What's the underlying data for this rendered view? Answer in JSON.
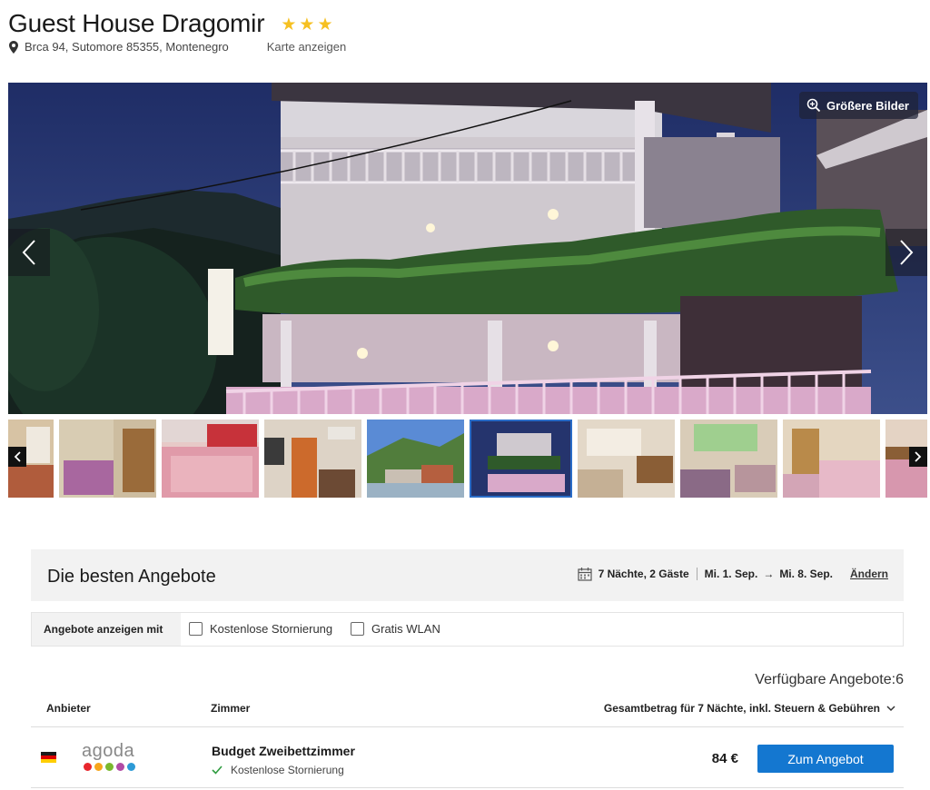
{
  "hotel": {
    "name": "Guest House Dragomir",
    "stars": 3,
    "address": "Brca 94, Sutomore 85355, Montenegro",
    "map_link": "Karte anzeigen"
  },
  "gallery": {
    "zoom_label": "Größere Bilder",
    "thumbnail_count": 10,
    "selected_thumbnail": 6
  },
  "offers": {
    "title": "Die besten Angebote",
    "stay": "7 Nächte, 2 Gäste",
    "checkin": "Mi. 1. Sep.",
    "arrow": "→",
    "checkout": "Mi. 8. Sep.",
    "change_link": "Ändern",
    "filter_label": "Angebote anzeigen mit",
    "filters": [
      "Kostenlose Stornierung",
      "Gratis WLAN"
    ],
    "available": "Verfügbare Angebote:6",
    "columns": {
      "provider": "Anbieter",
      "room": "Zimmer",
      "total": "Gesamtbetrag für 7 Nächte, inkl. Steuern & Gebühren"
    },
    "rows": [
      {
        "provider": "agoda",
        "room": "Budget Zweibettzimmer",
        "note": "Kostenlose Stornierung",
        "price": "84 €",
        "cta": "Zum Angebot"
      }
    ]
  },
  "colors": {
    "star": "#f6c021",
    "cta": "#1477d0",
    "check": "#2e9c3f",
    "agoda_dots": [
      "#e8262d",
      "#f7a51c",
      "#7ab82e",
      "#b14ba5",
      "#2d9ad6"
    ]
  },
  "icons": [
    "pin-icon",
    "zoom-icon",
    "chevron-left-icon",
    "chevron-right-icon",
    "calendar-icon",
    "checkmark-icon",
    "chevron-down-icon"
  ]
}
